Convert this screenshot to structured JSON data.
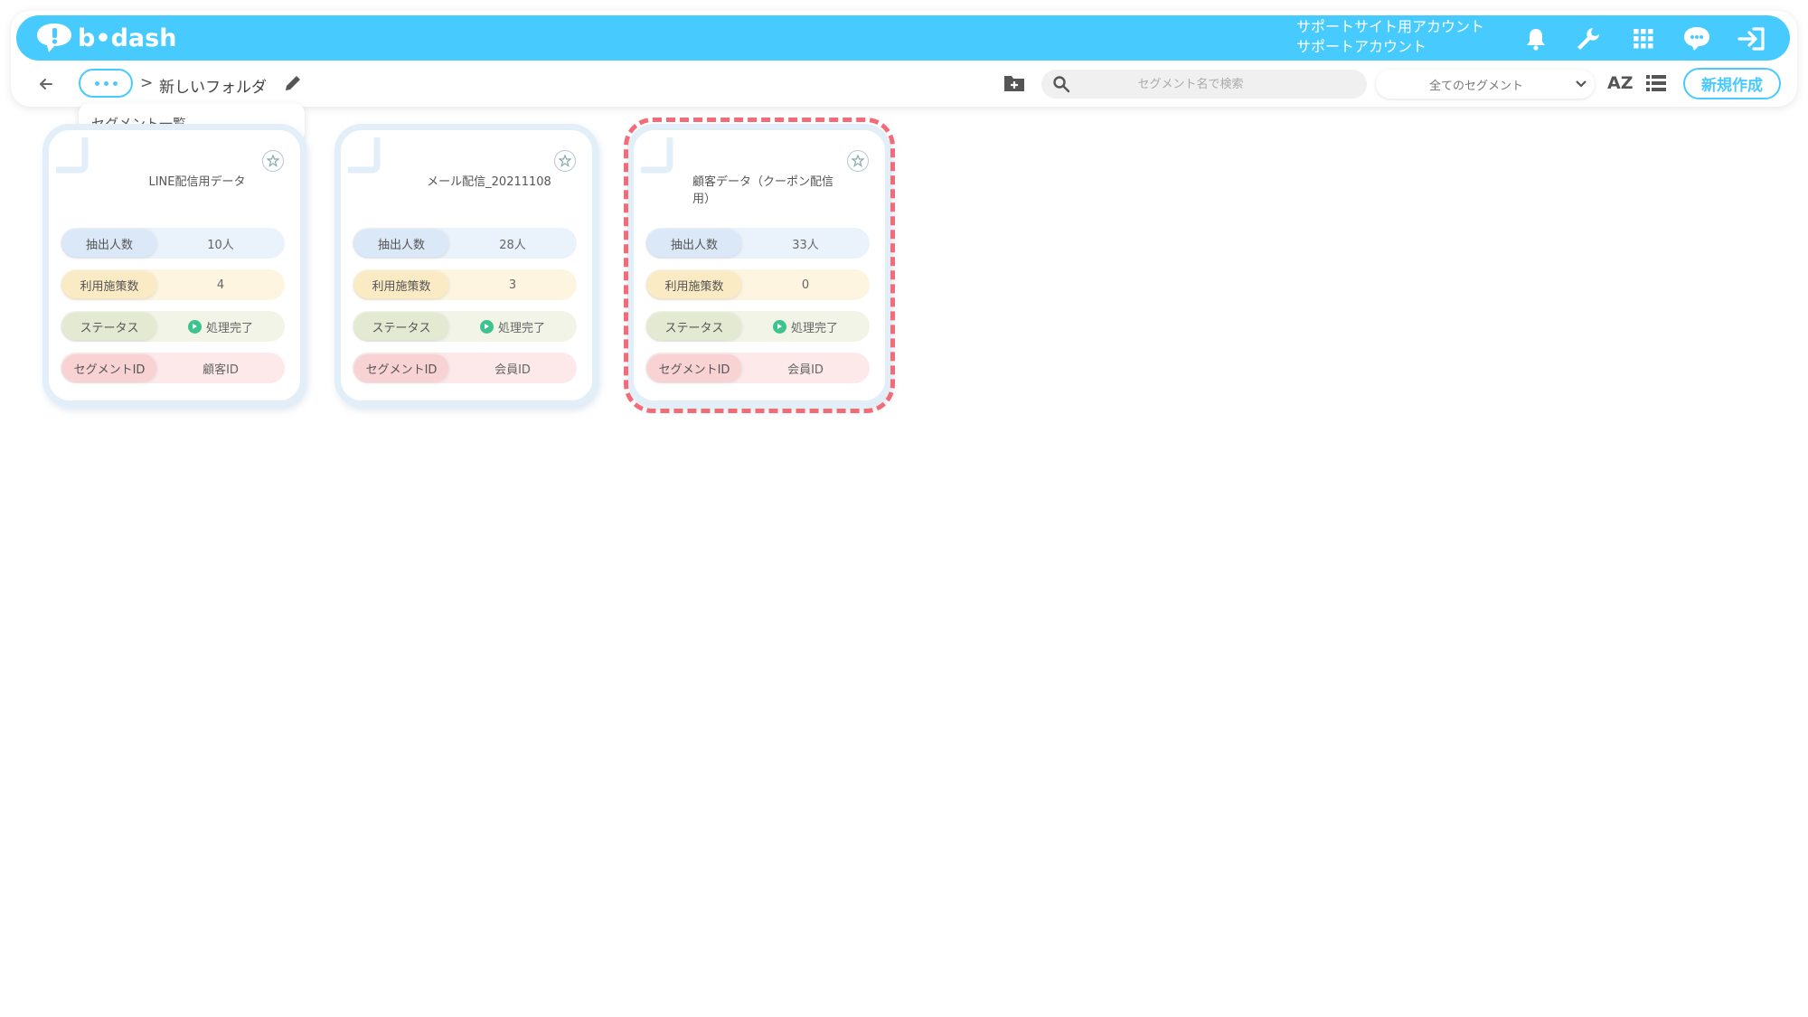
{
  "header": {
    "logo": "b•dash",
    "account_line1": "サポートサイト用アカウント",
    "account_line2": "サポートアカウント"
  },
  "toolbar": {
    "breadcrumb_sep": ">",
    "folder_name": "新しいフォルダ",
    "search_placeholder": "セグメント名で検索",
    "filter_label": "全てのセグメント",
    "sort_label": "AZ",
    "new_button": "新規作成"
  },
  "dropdown": {
    "item": "セグメント一覧"
  },
  "cards": [
    {
      "title": "LINE配信用データ",
      "extract_label": "抽出人数",
      "extract_value": "10人",
      "usage_label": "利用施策数",
      "usage_value": "4",
      "status_label": "ステータス",
      "status_value": "処理完了",
      "segid_label": "セグメントID",
      "segid_value": "顧客ID"
    },
    {
      "title": "メール配信_20211108",
      "extract_label": "抽出人数",
      "extract_value": "28人",
      "usage_label": "利用施策数",
      "usage_value": "3",
      "status_label": "ステータス",
      "status_value": "処理完了",
      "segid_label": "セグメントID",
      "segid_value": "会員ID"
    },
    {
      "title": "顧客データ（クーポン配信用）",
      "extract_label": "抽出人数",
      "extract_value": "33人",
      "usage_label": "利用施策数",
      "usage_value": "0",
      "status_label": "ステータス",
      "status_value": "処理完了",
      "segid_label": "セグメントID",
      "segid_value": "会員ID"
    }
  ],
  "colors": {
    "brand": "#47cbff",
    "highlight": "#f26c78",
    "status_ok": "#3cc48e"
  }
}
